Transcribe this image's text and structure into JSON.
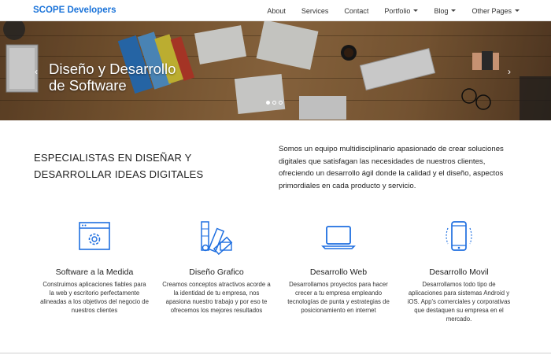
{
  "navbar": {
    "brand": "SCOPE Developers",
    "items": [
      {
        "label": "About"
      },
      {
        "label": "Services"
      },
      {
        "label": "Contact"
      },
      {
        "label": "Portfolio"
      },
      {
        "label": "Blog"
      },
      {
        "label": "Other Pages"
      }
    ]
  },
  "hero": {
    "title_line1": "Diseño y Desarrollo",
    "title_line2": "de Software",
    "prev": "‹",
    "next": "›"
  },
  "intro": {
    "heading_line1": "ESPECIALISTAS EN DISEÑAR Y",
    "heading_line2": "DESARROLLAR IDEAS DIGITALES",
    "text": "Somos un equipo multidisciplinario apasionado de crear soluciones digitales que satisfagan las necesidades de nuestros clientes, ofreciendo un desarrollo ágil donde la calidad y el diseño, aspectos primordiales en cada producto y servicio."
  },
  "cards": [
    {
      "title": "Software a la Medida",
      "desc": "Construimos aplicaciones fiables para la web y escritorio perfectamente alineadas a los objetivos del negocio de nuestros clientes",
      "icon": "web-settings-icon"
    },
    {
      "title": "Diseño Grafico",
      "desc": "Creamos conceptos atractivos acorde a la identidad de tu empresa, nos apasiona nuestro trabajo y por eso te ofrecemos los mejores resultados",
      "icon": "color-palette-icon"
    },
    {
      "title": "Desarrollo Web",
      "desc": "Desarrollamos proyectos para hacer crecer a tu empresa empleando tecnologías de punta y estrategias de posicionamiento en internet",
      "icon": "laptop-icon"
    },
    {
      "title": "Desarrollo Movil",
      "desc": "Desarrollamos todo tipo de aplicaciones para sistemas Android y iOS. App's comerciales y corporativas que destaquen su empresa en el mercado.",
      "icon": "smartphone-icon"
    }
  ],
  "colors": {
    "accent": "#1a73d9",
    "icon_blue": "#1f6fe0"
  }
}
